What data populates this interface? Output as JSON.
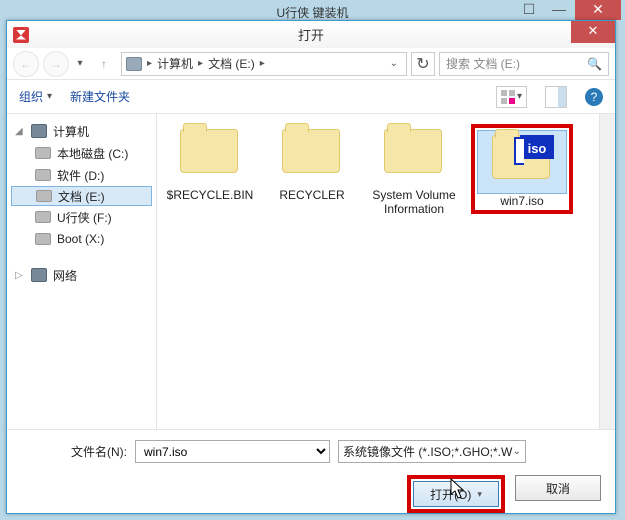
{
  "backdrop": {
    "title": "U行侠  键装机"
  },
  "dialog": {
    "title": "打开",
    "breadcrumb": {
      "seg1": "计算机",
      "seg2": "文档 (E:)"
    },
    "search_placeholder": "搜索 文档 (E:)"
  },
  "toolbar": {
    "organize": "组织",
    "newfolder": "新建文件夹"
  },
  "tree": {
    "root": "计算机",
    "items": [
      {
        "label": "本地磁盘 (C:)"
      },
      {
        "label": "软件 (D:)"
      },
      {
        "label": "文档 (E:)"
      },
      {
        "label": "U行侠 (F:)"
      },
      {
        "label": "Boot (X:)"
      }
    ],
    "network": "网络"
  },
  "files": [
    {
      "name": "$RECYCLE.BIN",
      "type": "folder"
    },
    {
      "name": "RECYCLER",
      "type": "folder"
    },
    {
      "name": "System Volume Information",
      "type": "folder"
    },
    {
      "name": "win7.iso",
      "type": "iso",
      "selected": true
    }
  ],
  "footer": {
    "filename_label": "文件名(N):",
    "filename_value": "win7.iso",
    "filter": "系统镜像文件 (*.ISO;*.GHO;*.W",
    "open": "打开(O)",
    "cancel": "取消"
  }
}
